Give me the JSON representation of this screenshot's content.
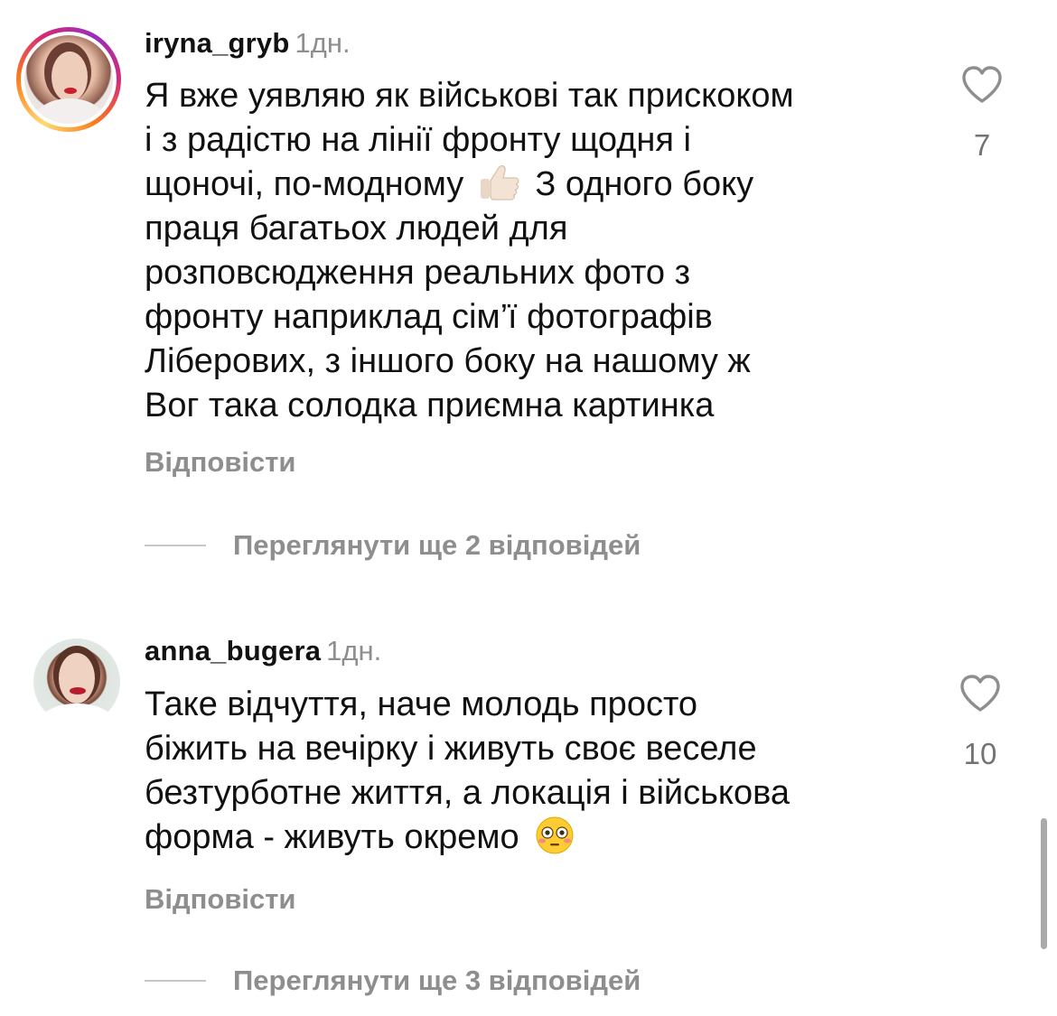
{
  "comments": [
    {
      "username": "iryna_gryb",
      "time": "1дн.",
      "text_lines": [
        "Я вже уявляю як військові так прискоком",
        "і з радістю на лінії фронту щодня і",
        "щоночі, по-модному",
        "З одного боку",
        "праця багатьох людей для",
        "розповсюдження реальних фото з",
        "фронту наприклад сім’ї фотографів",
        "Ліберових, з іншого боку на нашому ж",
        "Вог така солодка приємна картинка"
      ],
      "emoji": "thumbs-up-light-skin",
      "likes": "7",
      "reply_label": "Відповісти",
      "view_replies_label": "Переглянути ще 2 відповідей"
    },
    {
      "username": "anna_bugera",
      "time": "1дн.",
      "text_lines": [
        "Таке відчуття, наче молодь просто",
        "біжить на вечірку і живуть своє веселе",
        "безтурботне життя, а локація і військова",
        "форма - живуть окремо"
      ],
      "emoji": "flushed-face",
      "likes": "10",
      "reply_label": "Відповісти",
      "view_replies_label": "Переглянути ще 3 відповідей"
    }
  ],
  "colors": {
    "text": "#111111",
    "muted": "#8e8e8e",
    "story_ring": "#d62976"
  }
}
